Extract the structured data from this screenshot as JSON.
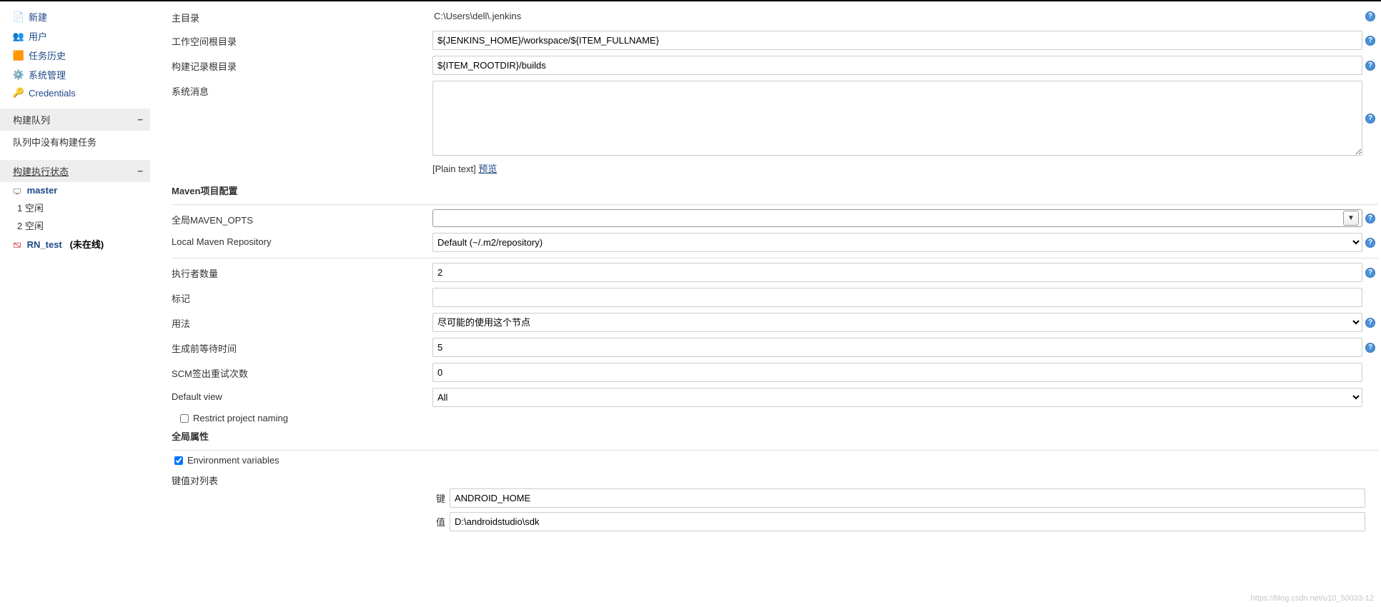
{
  "sidebar": {
    "nav": [
      {
        "icon": "📄",
        "label": "新建",
        "name": "nav-new"
      },
      {
        "icon": "👥",
        "label": "用户",
        "name": "nav-users"
      },
      {
        "icon": "🟧",
        "label": "任务历史",
        "name": "nav-history"
      },
      {
        "icon": "⚙️",
        "label": "系统管理",
        "name": "nav-manage"
      },
      {
        "icon": "🔑",
        "label": "Credentials",
        "name": "nav-credentials"
      }
    ],
    "buildQueue": {
      "title": "构建队列",
      "empty_text": "队列中没有构建任务"
    },
    "executor": {
      "title": "构建执行状态",
      "nodes": [
        {
          "name": "master",
          "online": true,
          "rows": [
            {
              "num": "1",
              "state": "空闲"
            },
            {
              "num": "2",
              "state": "空闲"
            }
          ]
        },
        {
          "name": "RN_test",
          "online": false,
          "offline_text": "(未在线)"
        }
      ]
    }
  },
  "form": {
    "home_dir_label": "主目录",
    "home_dir_value": "C:\\Users\\dell\\.jenkins",
    "workspace_label": "工作空间根目录",
    "workspace_value": "${JENKINS_HOME}/workspace/${ITEM_FULLNAME}",
    "build_record_label": "构建记录根目录",
    "build_record_value": "${ITEM_ROOTDIR}/builds",
    "sys_msg_label": "系统消息",
    "sys_msg_value": "",
    "preview_prefix": "[Plain text] ",
    "preview_link": "预览",
    "maven_section": "Maven项目配置",
    "maven_opts_label": "全局MAVEN_OPTS",
    "maven_opts_value": "",
    "maven_repo_label": "Local Maven Repository",
    "maven_repo_value": "Default (~/.m2/repository)",
    "executors_label": "执行者数量",
    "executors_value": "2",
    "labels_label": "标记",
    "labels_value": "",
    "usage_label": "用法",
    "usage_value": "尽可能的使用这个节点",
    "quiet_label": "生成前等待时间",
    "quiet_value": "5",
    "scm_retry_label": "SCM签出重试次数",
    "scm_retry_value": "0",
    "default_view_label": "Default view",
    "default_view_value": "All",
    "restrict_label": "Restrict project naming",
    "global_props_title": "全局属性",
    "env_vars_label": "Environment variables",
    "kv_list_label": "键值对列表",
    "kv_key_label": "键",
    "kv_key_value": "ANDROID_HOME",
    "kv_val_label": "值",
    "kv_val_value": "D:\\androidstudio\\sdk"
  },
  "watermark": "https://blog.csdn.net/u10_50033-12"
}
